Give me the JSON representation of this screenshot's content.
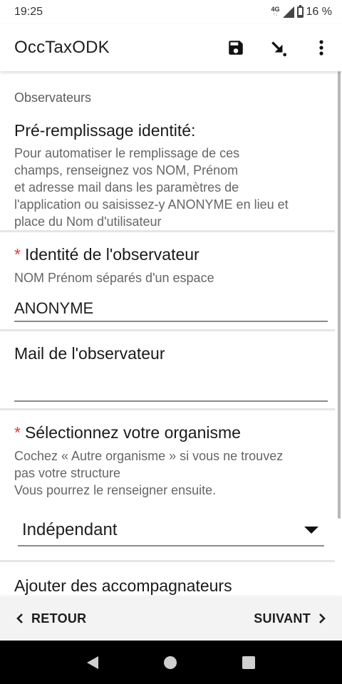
{
  "status_bar": {
    "time": "19:25",
    "network": "4G",
    "battery": "16 %",
    "battery_level": 0.16
  },
  "app_bar": {
    "title": "OccTaxODK",
    "icons": [
      "save-icon",
      "goto-icon",
      "more-vert-icon"
    ]
  },
  "form": {
    "group_label": "Observateurs",
    "prefill": {
      "title": "Pré-remplissage identité:",
      "hint_lines": [
        "Pour automatiser le remplissage de ces",
        "champs, renseignez vos NOM, Prénom",
        "et adresse mail dans les paramètres de",
        "l'application ou saisissez-y ANONYME en lieu et",
        "place du Nom d'utilisateur"
      ]
    },
    "identity": {
      "required_marker": "*",
      "label": "Identité de l'observateur",
      "hint": "NOM Prénom séparés d'un espace",
      "value": "ANONYME"
    },
    "mail": {
      "label": "Mail de l'observateur",
      "value": ""
    },
    "organism": {
      "required_marker": "*",
      "label": "Sélectionnez votre organisme",
      "hint_lines": [
        "Cochez « Autre organisme » si vous ne trouvez",
        "pas votre structure",
        "Vous pourrez le renseigner ensuite."
      ],
      "selected": "Indépendant"
    },
    "companions": {
      "label": "Ajouter des accompagnateurs"
    }
  },
  "bottom_nav": {
    "back_label": "RETOUR",
    "next_label": "SUIVANT"
  }
}
